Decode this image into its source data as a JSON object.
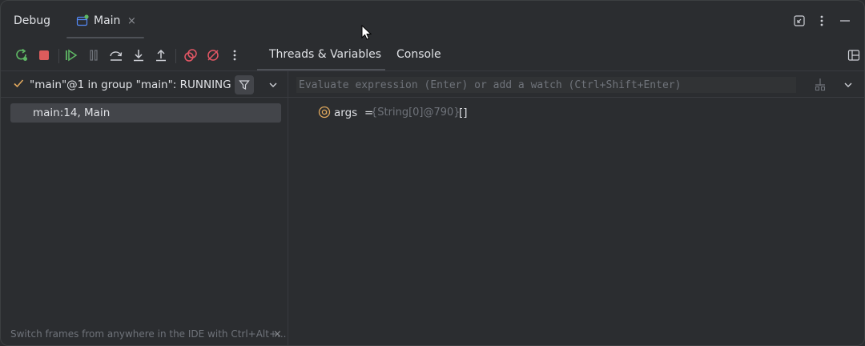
{
  "header": {
    "title": "Debug",
    "tab_label": "Main",
    "tab_close": "×"
  },
  "toolbar": {
    "icons": [
      "rerun-icon",
      "stop-icon",
      "resume-icon",
      "pause-icon",
      "step-over-icon",
      "step-into-icon",
      "step-out-icon",
      "view-breakpoints-icon",
      "mute-breakpoints-icon",
      "more-icon"
    ],
    "tabs": [
      {
        "label": "Threads & Variables"
      },
      {
        "label": "Console"
      }
    ]
  },
  "threads": {
    "current": "\"main\"@1 in group \"main\": RUNNING"
  },
  "evaluate": {
    "placeholder": "Evaluate expression (Enter) or add a watch (Ctrl+Shift+Enter)"
  },
  "frames": [
    {
      "label": "main:14, Main"
    }
  ],
  "variables": [
    {
      "name": "args",
      "equals": "=",
      "type": "{String[0]@790}",
      "value": "[]"
    }
  ],
  "hint": {
    "text": "Switch frames from anywhere in the IDE with Ctrl+Alt+...",
    "close": "×"
  },
  "colors": {
    "background": "#2b2d30",
    "accent_green": "#5fb865",
    "stop_red": "#db5c5c",
    "breakpoint_red": "#e55765"
  }
}
